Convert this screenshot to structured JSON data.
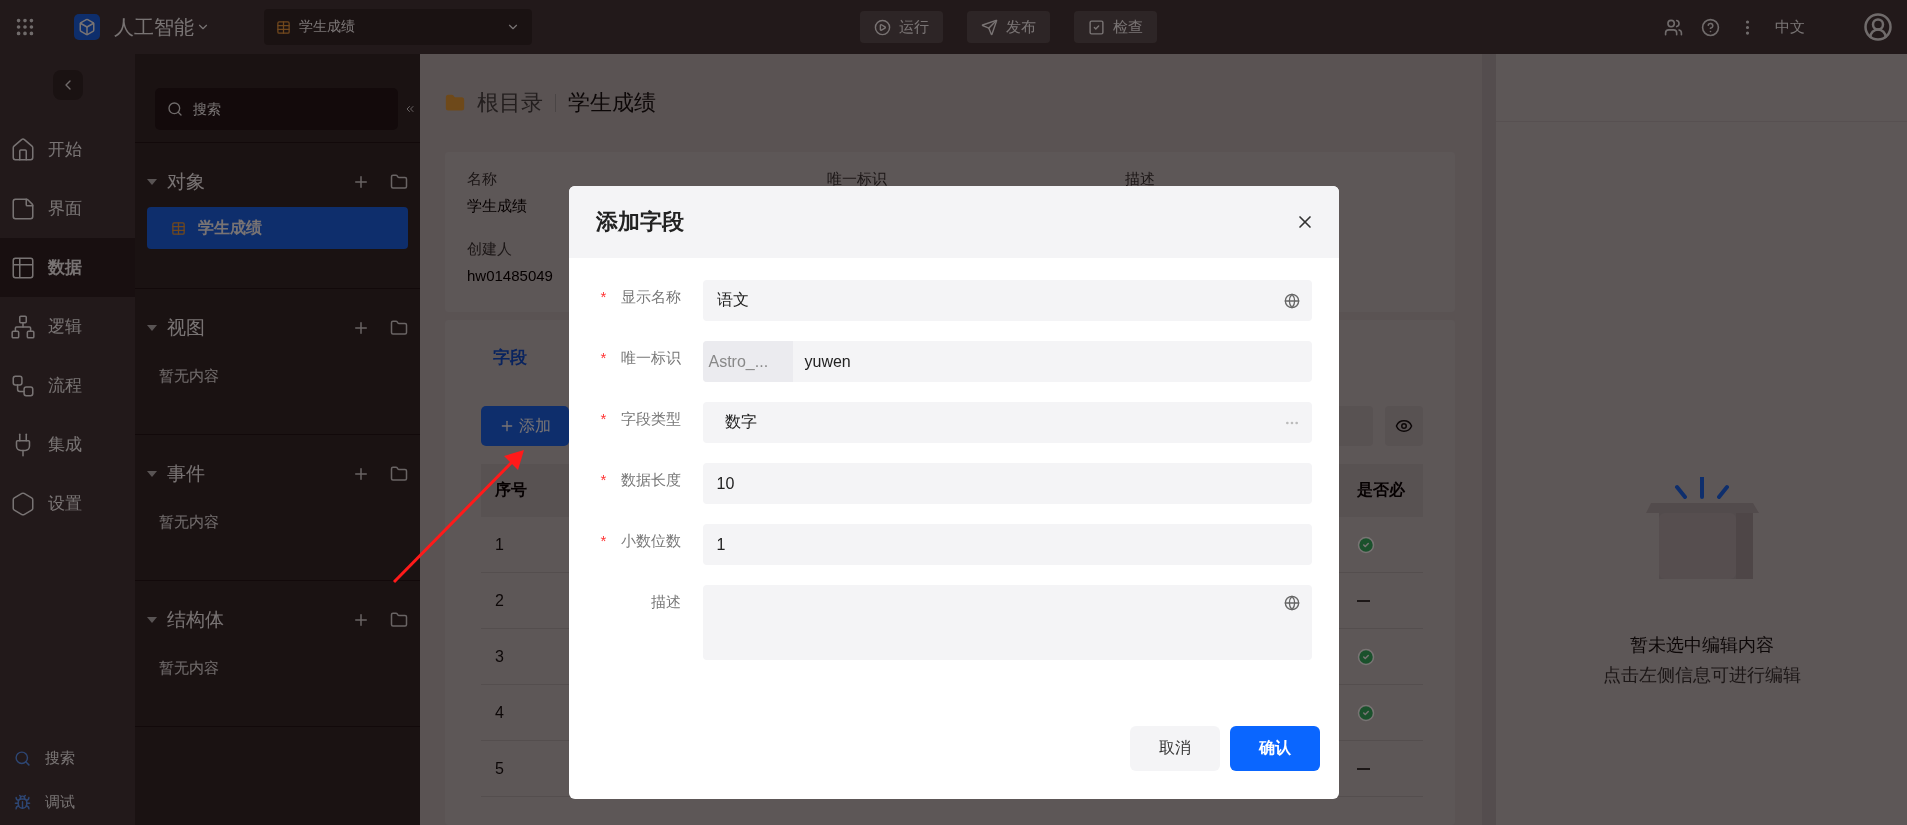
{
  "top_bar": {
    "app_name": "人工智能",
    "page_select": {
      "value": "学生成绩"
    },
    "actions": [
      {
        "label": "运行",
        "kind": "run"
      },
      {
        "label": "发布",
        "kind": "publish"
      },
      {
        "label": "检查",
        "kind": "check"
      }
    ],
    "language": "中文"
  },
  "nav": {
    "items": [
      {
        "label": "开始",
        "selected": false
      },
      {
        "label": "界面",
        "selected": false
      },
      {
        "label": "数据",
        "selected": true
      },
      {
        "label": "逻辑",
        "selected": false
      },
      {
        "label": "流程",
        "selected": false
      },
      {
        "label": "集成",
        "selected": false
      },
      {
        "label": "设置",
        "selected": false
      }
    ],
    "footer": [
      {
        "label": "搜索",
        "kind": "search"
      },
      {
        "label": "调试",
        "kind": "debug"
      }
    ]
  },
  "tree": {
    "search": {
      "placeholder": "搜索"
    },
    "sections": [
      {
        "title": "对象",
        "expanded": true,
        "items": [
          {
            "label": "学生成绩",
            "selected": true
          }
        ]
      },
      {
        "title": "视图",
        "expanded": true,
        "empty_text": "暂无内容"
      },
      {
        "title": "事件",
        "expanded": true,
        "empty_text": "暂无内容"
      },
      {
        "title": "结构体",
        "expanded": true,
        "empty_text": "暂无内容"
      }
    ]
  },
  "main": {
    "breadcrumb": [
      "根目录",
      "学生成绩"
    ],
    "info": [
      {
        "label": "名称",
        "value": "学生成绩"
      },
      {
        "label": "唯一标识"
      },
      {
        "label": "描述"
      },
      {
        "label": "创建人",
        "value": "hw01485049"
      }
    ],
    "tabs": [
      {
        "label": "字段",
        "selected": true
      }
    ],
    "add_button": "添加",
    "table": {
      "columns": [
        "序号",
        "是否必"
      ],
      "rows": [
        {
          "index": "1",
          "required": true
        },
        {
          "index": "2",
          "required": false
        },
        {
          "index": "3",
          "required": true
        },
        {
          "index": "4",
          "required": true
        },
        {
          "index": "5",
          "required": false
        }
      ]
    }
  },
  "dialog": {
    "title": "添加字段",
    "fields": [
      {
        "label": "显示名称",
        "required_mark": "*",
        "kind": "i18n",
        "value": "语文"
      },
      {
        "label": "唯一标识",
        "required_mark": "*",
        "kind": "prefixed",
        "prefix": "Astro_...",
        "value": "yuwen"
      },
      {
        "label": "字段类型",
        "required_mark": "*",
        "kind": "picker",
        "value": "数字"
      },
      {
        "label": "数据长度",
        "required_mark": "*",
        "kind": "text",
        "value": "10"
      },
      {
        "label": "小数位数",
        "required_mark": "*",
        "kind": "text",
        "value": "1"
      },
      {
        "label": "描述",
        "kind": "textarea"
      }
    ],
    "buttons": [
      {
        "label": "取消",
        "kind": "secondary"
      },
      {
        "label": "确认",
        "kind": "primary"
      }
    ]
  },
  "inspector": {
    "title": "暂未选中编辑内容",
    "hint": "点击左侧信息可进行编辑"
  }
}
